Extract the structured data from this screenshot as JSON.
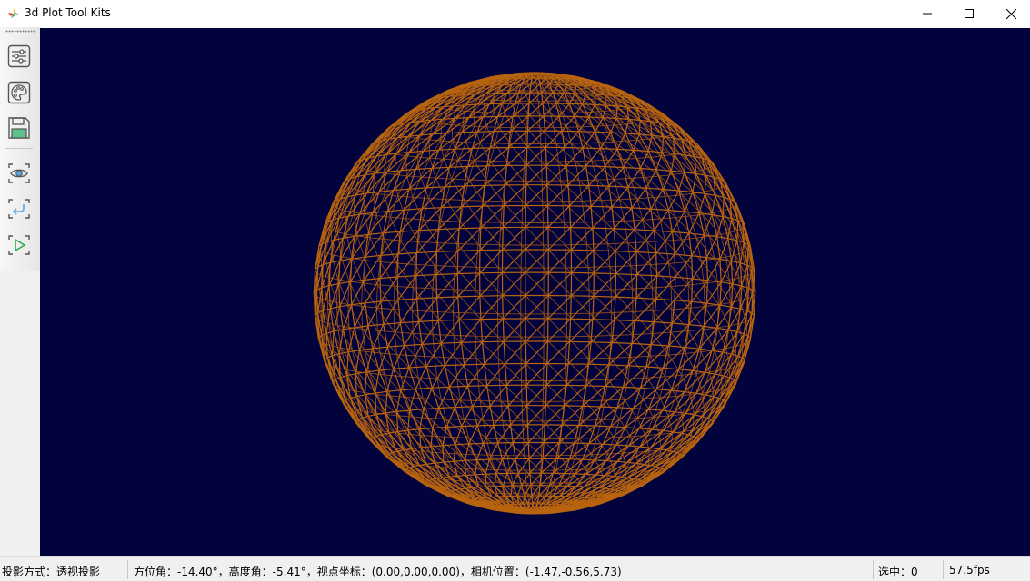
{
  "window": {
    "title": "3d Plot Tool Kits"
  },
  "toolbar": {
    "buttons": [
      {
        "icon": "sliders-icon",
        "label": "settings"
      },
      {
        "icon": "palette-icon",
        "label": "color"
      },
      {
        "icon": "save-icon",
        "label": "save"
      },
      {
        "icon": "eye-icon",
        "label": "view"
      },
      {
        "icon": "reset-icon",
        "label": "reset"
      },
      {
        "icon": "play-icon",
        "label": "play"
      }
    ]
  },
  "viewport": {
    "background_color": "#02023c",
    "mesh_color": "#b8640f",
    "object": "wireframe-sphere"
  },
  "status": {
    "projection": "投影方式：透视投影",
    "camera_info": "方位角：-14.40°，高度角：-5.41°，视点坐标：(0.00,0.00,0.00)，相机位置：(-1.47,-0.56,5.73)",
    "selected": "选中：0",
    "fps": "57.5fps"
  }
}
